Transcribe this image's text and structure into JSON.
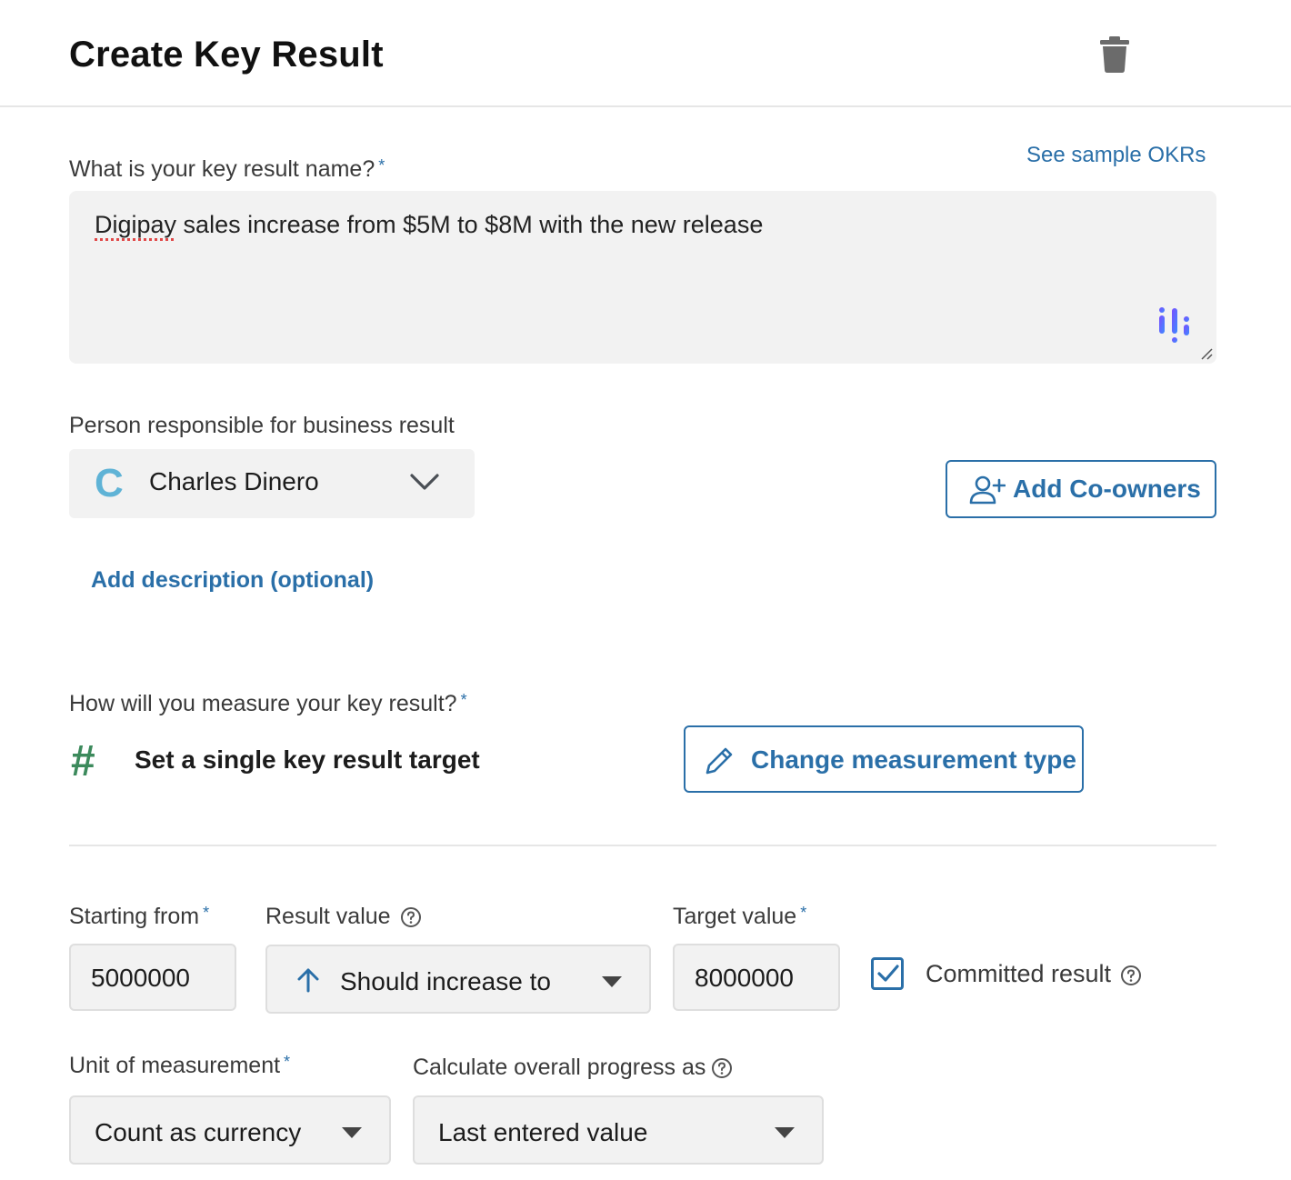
{
  "header": {
    "title": "Create Key Result",
    "delete_icon": "trash-icon"
  },
  "name_section": {
    "label": "What is your key result name?",
    "required_mark": "*",
    "sample_link": "See sample OKRs",
    "value_misspelled": "Digipay",
    "value_rest": " sales increase from $5M to $8M with the new release"
  },
  "owner_section": {
    "label": "Person responsible for business result",
    "avatar_letter": "C",
    "avatar_color": "#5fb3d6",
    "selected": "Charles Dinero",
    "add_coowners": "Add Co-owners"
  },
  "description_link": "Add description (optional)",
  "measurement": {
    "label": "How will you measure your key result?",
    "required_mark": "*",
    "icon": "#",
    "type_text": "Set a single key result target",
    "change_button": "Change measurement type"
  },
  "values": {
    "starting_label": "Starting from",
    "starting_value": "5000000",
    "result_label": "Result value",
    "result_selected": "Should increase to",
    "target_label": "Target value",
    "target_value": "8000000",
    "committed_label": "Committed result",
    "committed_checked": true,
    "required_mark": "*"
  },
  "unit": {
    "label": "Unit of measurement",
    "selected": "Count as currency",
    "required_mark": "*"
  },
  "progress": {
    "label": "Calculate overall progress as",
    "selected": "Last entered value"
  },
  "colors": {
    "accent": "#2a6fa8",
    "hash_icon": "#3c8a5c",
    "field_bg": "#f2f2f2"
  }
}
